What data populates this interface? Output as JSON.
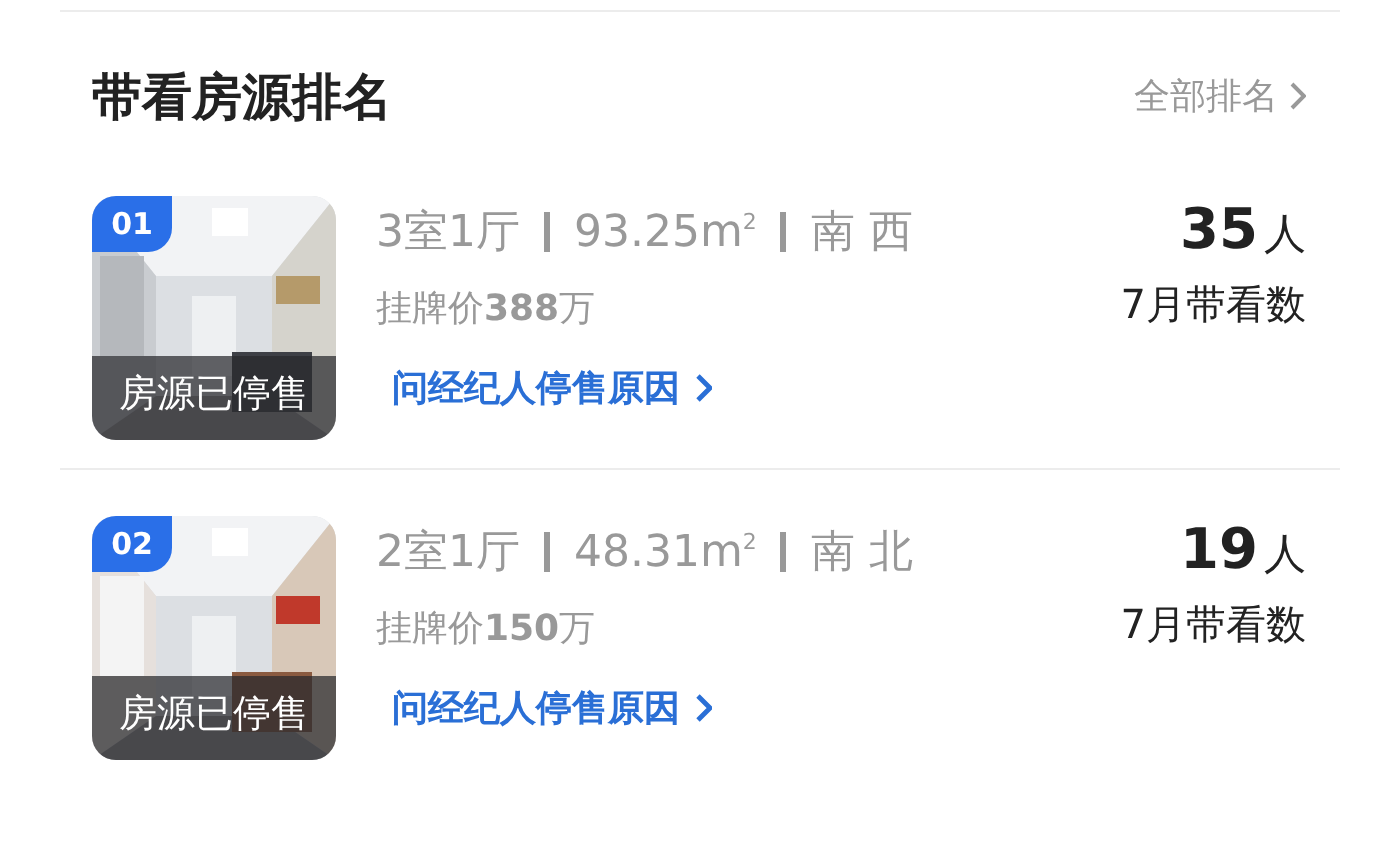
{
  "header": {
    "title": "带看房源排名",
    "more_link": "全部排名"
  },
  "listings": [
    {
      "rank": "01",
      "status": "房源已停售",
      "layout": "3室1厅",
      "area": "93.25m$^{2}$",
      "orientation": "南 西",
      "price": "挂牌价**388**万",
      "link": "问经纪人停售原因",
      "count": "35",
      "count_unit": "人",
      "count_label": "7月带看数"
    },
    {
      "rank": "02",
      "status": "房源已停售",
      "layout": "2室1厅",
      "area": "48.31m$^{2}$",
      "orientation": "南 北",
      "price": "挂牌价**150**万",
      "link": "问经纪人停售原因",
      "count": "19",
      "count_unit": "人",
      "count_label": "7月带看数"
    }
  ]
}
